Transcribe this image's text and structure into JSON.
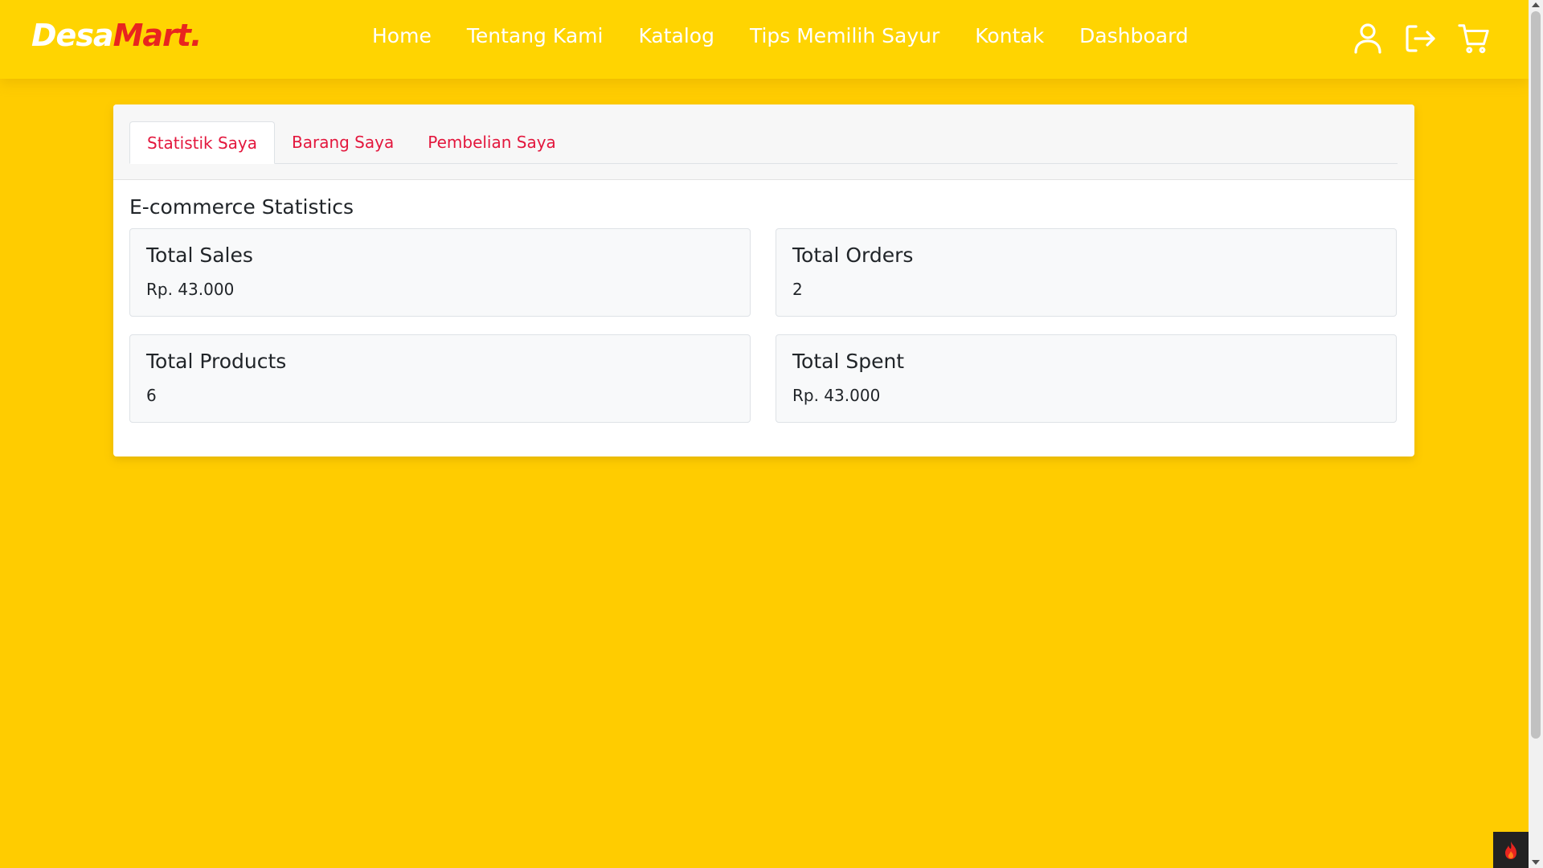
{
  "brand": {
    "part1": "Desa",
    "part2": "Mart",
    "dot": "."
  },
  "nav": {
    "links": [
      "Home",
      "Tentang Kami",
      "Katalog",
      "Tips Memilih Sayur",
      "Kontak",
      "Dashboard"
    ],
    "icons": [
      "user-icon",
      "logout-icon",
      "cart-icon"
    ]
  },
  "tabs": [
    "Statistik Saya",
    "Barang Saya",
    "Pembelian Saya"
  ],
  "active_tab": "Statistik Saya",
  "section_title": "E-commerce Statistics",
  "stats": [
    {
      "title": "Total Sales",
      "value": "Rp. 43.000"
    },
    {
      "title": "Total Orders",
      "value": "2"
    },
    {
      "title": "Total Products",
      "value": "6"
    },
    {
      "title": "Total Spent",
      "value": "Rp. 43.000"
    }
  ],
  "colors": {
    "background": "#ffcc00",
    "navbar": "#ffd401",
    "accent": "#e8251f",
    "tab_text": "#e3173d"
  },
  "corner_widget_icon": "flame-icon"
}
